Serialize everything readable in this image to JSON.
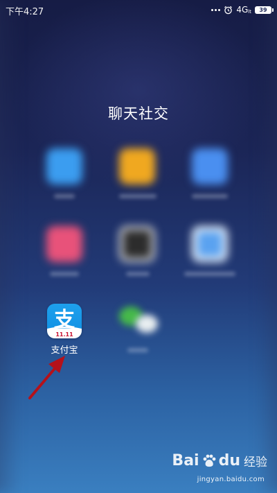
{
  "status_bar": {
    "time": "下午4:27",
    "network": "4G",
    "network_sub": "lt",
    "battery": "39"
  },
  "folder": {
    "title": "聊天社交"
  },
  "apps": {
    "alipay": {
      "label": "支付宝",
      "glyph": "支",
      "badge": "11.11",
      "icon": "alipay-icon",
      "color": "#1296e6"
    },
    "blurred_colors": {
      "app1": "#3b9df0",
      "app2": "#f0a820",
      "app3": "#4a8ff0",
      "app4": "#e8527a",
      "app5": "#2c2c2c",
      "app6": "#5aa2f0",
      "wechat": "#46b94a"
    }
  },
  "annotation": {
    "arrow_color": "#b5111a"
  },
  "watermark": {
    "brand_left": "Bai",
    "brand_right": "du",
    "jingyan": "经验",
    "url": "jingyan.baidu.com"
  }
}
